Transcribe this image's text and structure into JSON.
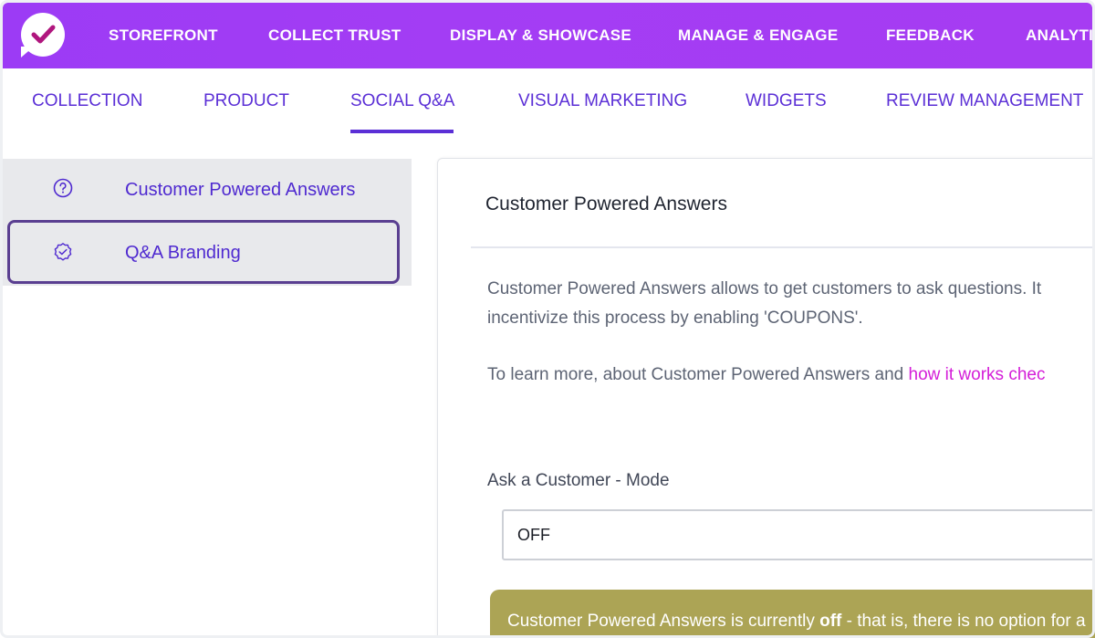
{
  "top_nav": {
    "items": [
      {
        "label": "STOREFRONT"
      },
      {
        "label": "COLLECT TRUST"
      },
      {
        "label": "DISPLAY & SHOWCASE"
      },
      {
        "label": "MANAGE & ENGAGE"
      },
      {
        "label": "FEEDBACK"
      },
      {
        "label": "ANALYTICS"
      }
    ]
  },
  "sub_nav": {
    "items": [
      {
        "label": "COLLECTION"
      },
      {
        "label": "PRODUCT"
      },
      {
        "label": "SOCIAL Q&A"
      },
      {
        "label": "VISUAL MARKETING"
      },
      {
        "label": "WIDGETS"
      },
      {
        "label": "REVIEW MANAGEMENT"
      }
    ],
    "active": "SOCIAL Q&A"
  },
  "sidebar": {
    "items": [
      {
        "label": "Customer Powered Answers",
        "icon": "question-circle-icon"
      },
      {
        "label": "Q&A Branding",
        "icon": "badge-check-icon"
      }
    ],
    "active": "Q&A Branding"
  },
  "panel": {
    "title": "Customer Powered Answers",
    "para1_line1": "Customer Powered Answers allows to get customers to ask questions. It",
    "para1_line2": "incentivize this process by enabling 'COUPONS'.",
    "para2_text": "To learn more, about Customer Powered Answers and ",
    "para2_link": "how it works chec",
    "field_label": "Ask a Customer - Mode",
    "select_value": "OFF",
    "notice_prefix": "Customer Powered Answers is currently ",
    "notice_bold": "off",
    "notice_suffix": " - that is, there is no option for a"
  },
  "colors": {
    "top_nav_bg": "#a03cf4",
    "accent": "#5b2fd6",
    "link": "#d41ed8",
    "notice_bg": "#aca455"
  }
}
